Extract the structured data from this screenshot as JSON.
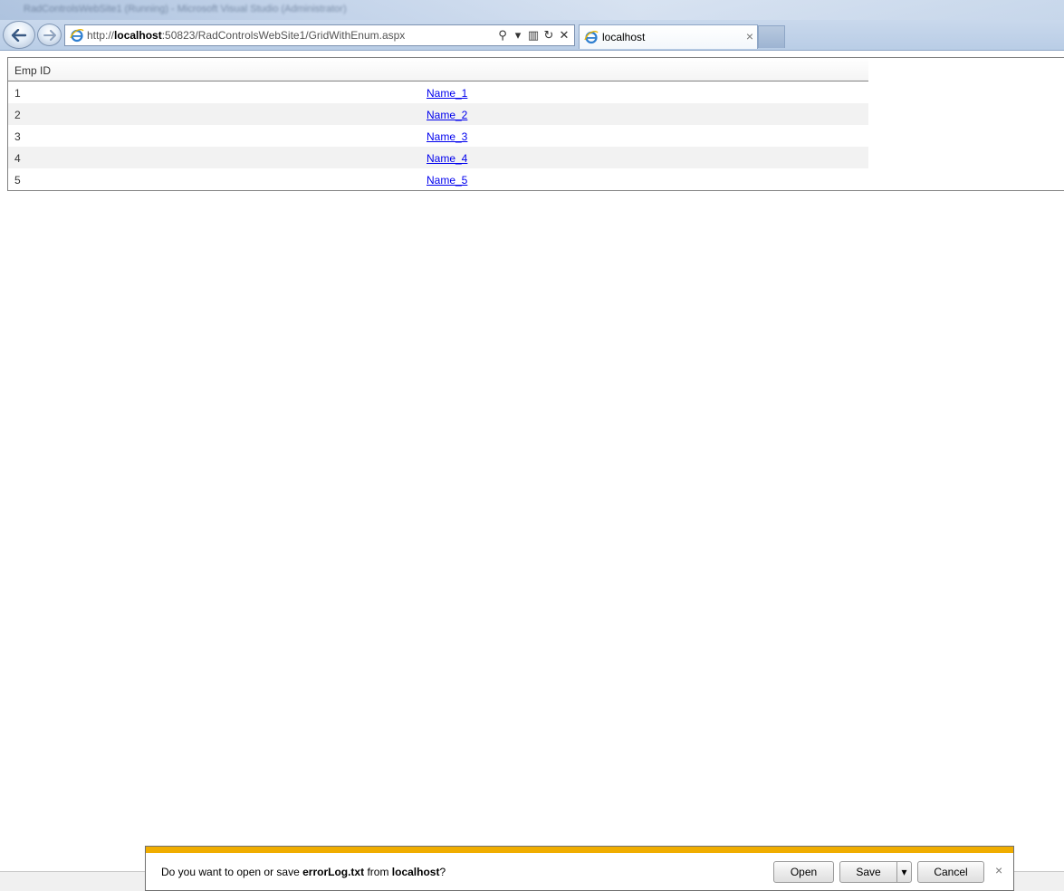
{
  "browser": {
    "window_title": "RadControlsWebSite1 (Running) - Microsoft Visual Studio (Administrator)",
    "address": {
      "prefix": "http://",
      "host": "localhost",
      "rest": ":50823/RadControlsWebSite1/GridWithEnum.aspx"
    },
    "tab": {
      "label": "localhost",
      "close_glyph": "×"
    },
    "tools": {
      "search_glyph": "⚲",
      "dropdown_glyph": "▾",
      "compat_glyph": "▥",
      "refresh_glyph": "↻",
      "stop_glyph": "✕"
    }
  },
  "grid": {
    "header": "Emp ID",
    "rows": [
      {
        "id": "1",
        "name": "Name_1"
      },
      {
        "id": "2",
        "name": "Name_2"
      },
      {
        "id": "3",
        "name": "Name_3"
      },
      {
        "id": "4",
        "name": "Name_4"
      },
      {
        "id": "5",
        "name": "Name_5"
      }
    ]
  },
  "notification": {
    "prefix": "Do you want to open or save ",
    "filename": "errorLog.txt",
    "middle": " from ",
    "source": "localhost",
    "suffix": "?",
    "open_label": "Open",
    "save_label": "Save",
    "save_drop_glyph": "▾",
    "cancel_label": "Cancel",
    "close_glyph": "×",
    "accent_color": "#f0ad00"
  }
}
